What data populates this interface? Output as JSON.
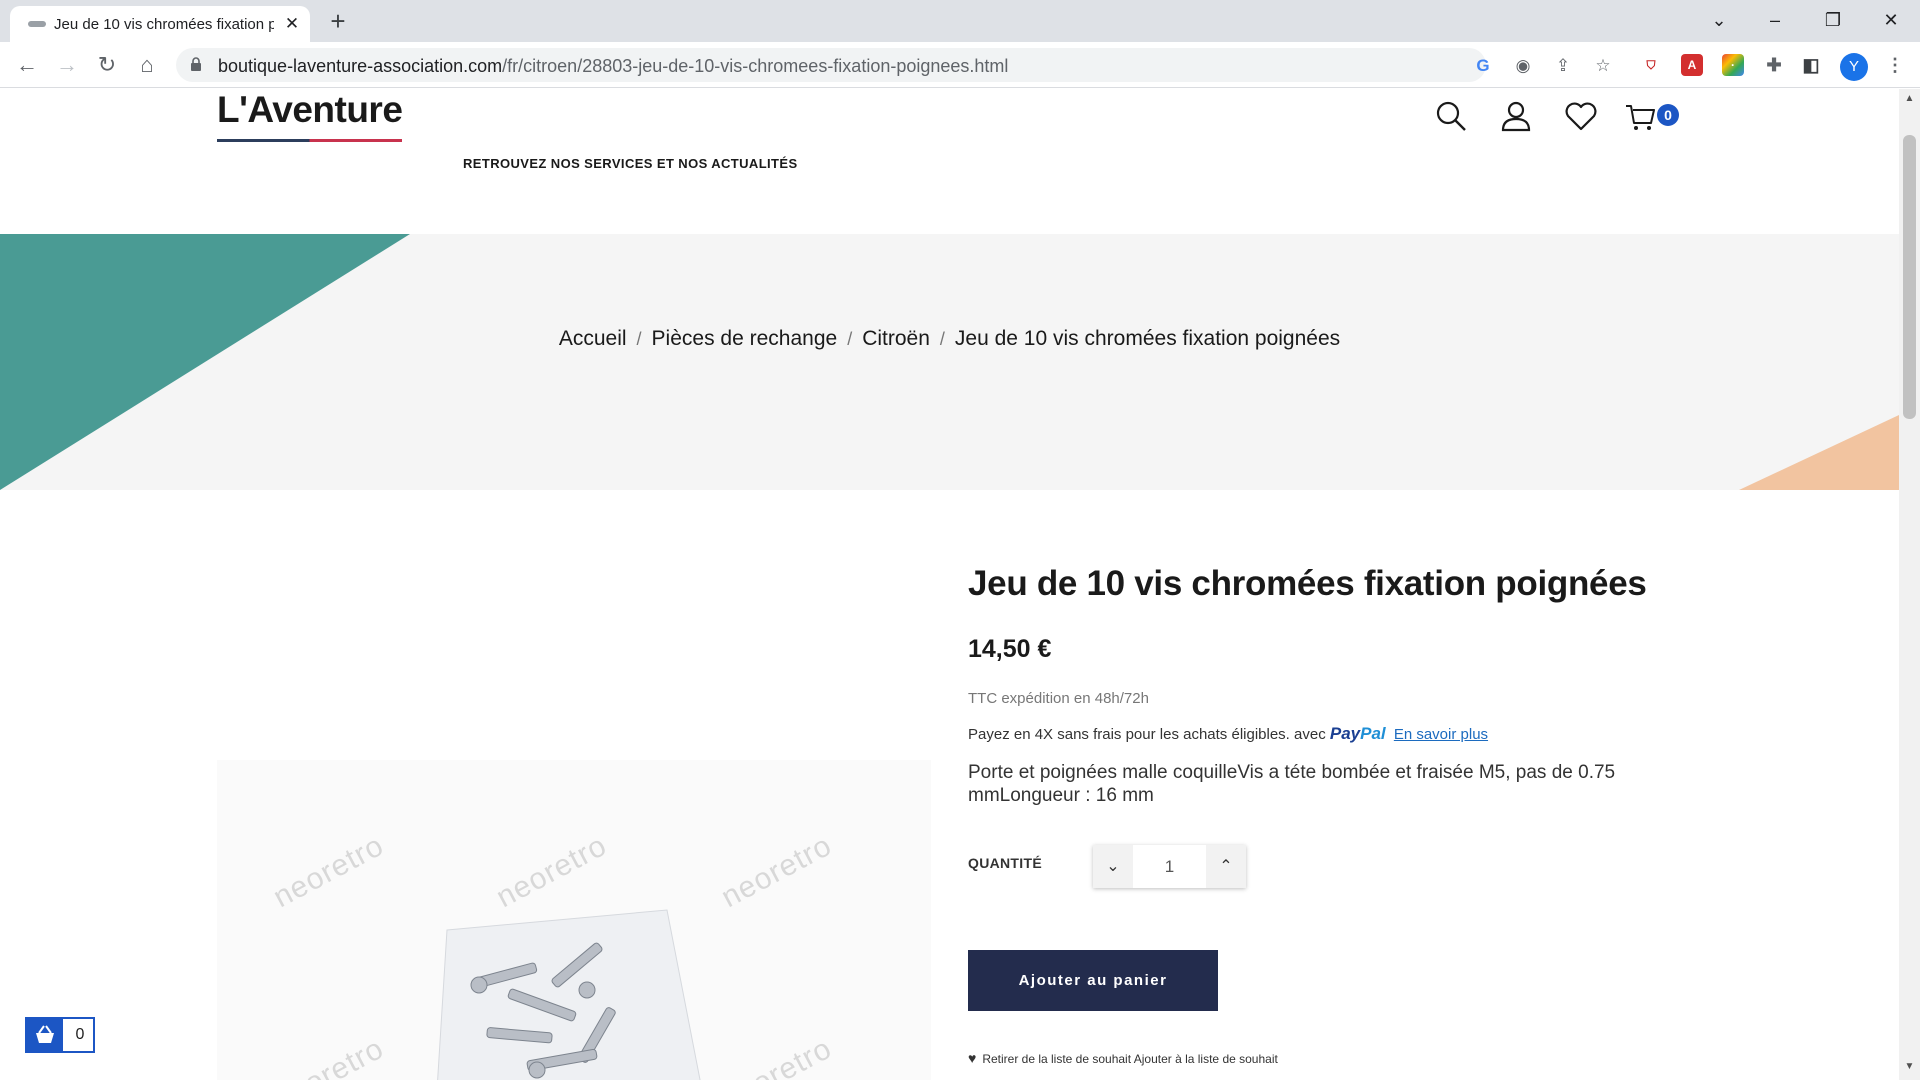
{
  "browser": {
    "tab_title": "Jeu de 10 vis chromées fixation p",
    "url_domain": "boutique-laventure-association.com",
    "url_path": "/fr/citroen/28803-jeu-de-10-vis-chromees-fixation-poignees.html",
    "profile_initial": "Y",
    "new_tab_glyph": "+",
    "close_glyph": "✕"
  },
  "header": {
    "logo": "L'Aventure",
    "services_link": "RETROUVEZ NOS SERVICES ET NOS ACTUALITÉS",
    "cart_count": "0"
  },
  "breadcrumb": {
    "items": [
      "Accueil",
      "Pièces de rechange",
      "Citroën",
      "Jeu de 10 vis chromées fixation poignées"
    ],
    "separator": "/"
  },
  "product": {
    "title": "Jeu de 10 vis chromées fixation poignées",
    "price": "14,50 €",
    "tax_shipping": "TTC expédition en 48h/72h",
    "paypal_text": "Payez en 4X sans frais pour les achats éligibles. avec",
    "paypal_brand_1": "Pay",
    "paypal_brand_2": "Pal",
    "paypal_more": "En savoir plus",
    "description": "Porte et poignées malle coquilleVis a téte bombée et fraisée M5, pas de 0.75 mmLongueur : 16 mm",
    "quantity_label": "QUANTITÉ",
    "quantity_value": "1",
    "add_to_cart": "Ajouter au panier",
    "wishlist_text": "Retirer de la liste de souhait Ajouter à la liste de souhait",
    "watermark": "neoretro"
  },
  "floating_cart": {
    "count": "0"
  },
  "colors": {
    "teal": "#4a9b94",
    "peach": "#f2c4a0",
    "button_dark": "#232c4d",
    "badge_blue": "#1c56c4",
    "logo_blue": "#2c3e5c",
    "logo_red": "#c8334e"
  }
}
